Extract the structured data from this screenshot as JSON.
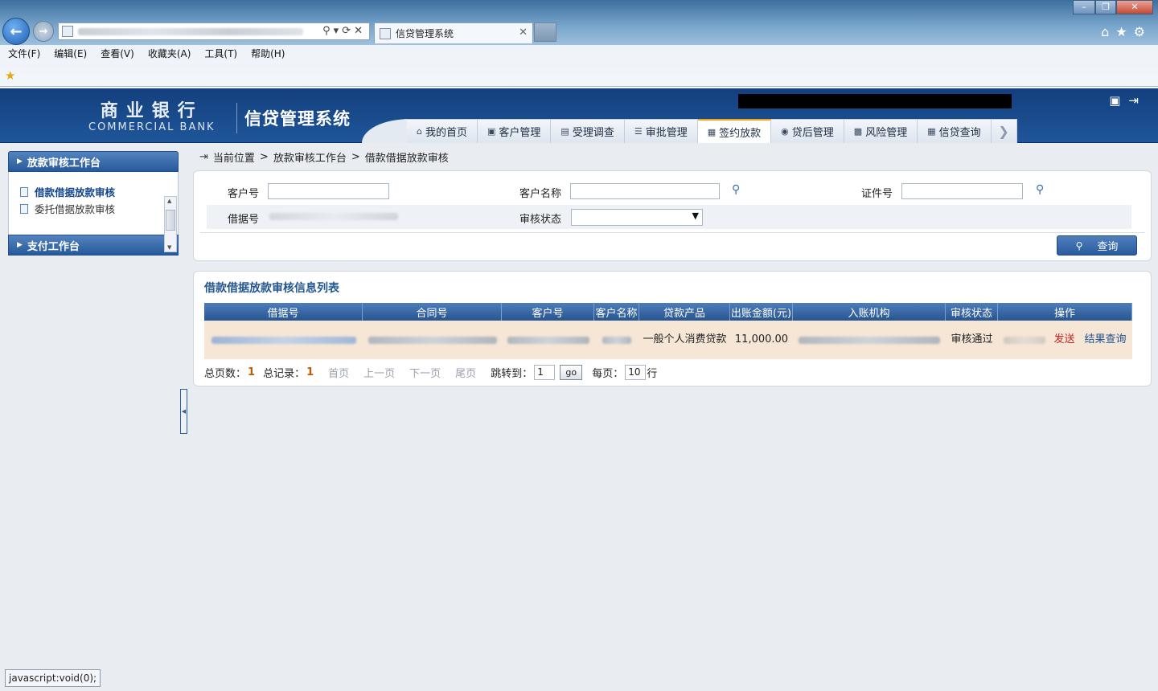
{
  "browser": {
    "tab_title": "信贷管理系统",
    "menu": [
      "文件(F)",
      "编辑(E)",
      "查看(V)",
      "收藏夹(A)",
      "工具(T)",
      "帮助(H)"
    ],
    "status_text": "javascript:void(0);"
  },
  "header": {
    "logo_cn": "商业银行",
    "logo_en": "COMMERCIAL BANK",
    "system_title": "信贷管理系统",
    "nav_tabs": [
      {
        "label": "我的首页",
        "icon": "home-icon"
      },
      {
        "label": "客户管理",
        "icon": "customer-icon"
      },
      {
        "label": "受理调查",
        "icon": "survey-icon"
      },
      {
        "label": "审批管理",
        "icon": "approval-icon"
      },
      {
        "label": "签约放款",
        "icon": "contract-icon",
        "active": true
      },
      {
        "label": "贷后管理",
        "icon": "postloan-icon"
      },
      {
        "label": "风险管理",
        "icon": "risk-icon"
      },
      {
        "label": "信贷查询",
        "icon": "query-icon"
      }
    ]
  },
  "sidebar": {
    "section1": "放款审核工作台",
    "items": [
      {
        "label": "借款借据放款审核",
        "active": true
      },
      {
        "label": "委托借据放款审核",
        "active": false
      }
    ],
    "section2": "支付工作台"
  },
  "breadcrumb": {
    "prefix": "当前位置",
    "items": [
      "放款审核工作台",
      "借款借据放款审核"
    ],
    "sep": ">"
  },
  "search": {
    "customer_no_label": "客户号",
    "customer_name_label": "客户名称",
    "id_no_label": "证件号",
    "loan_no_label": "借据号",
    "status_label": "审核状态",
    "query_button": "查询"
  },
  "list": {
    "title": "借款借据放款审核信息列表",
    "columns": [
      "借据号",
      "合同号",
      "客户号",
      "客户名称",
      "贷款产品",
      "出账金额(元)",
      "入账机构",
      "审核状态",
      "操作"
    ],
    "rows": [
      {
        "product": "一般个人消费贷款",
        "amount": "11,000.00",
        "status": "审核通过",
        "action_send": "发送",
        "action_result": "结果查询"
      }
    ]
  },
  "pager": {
    "total_pages_label": "总页数：",
    "total_pages": "1",
    "total_records_label": "总记录：",
    "total_records": "1",
    "first": "首页",
    "prev": "上一页",
    "next": "下一页",
    "last": "尾页",
    "jump_label": "跳转到：",
    "jump_value": "1",
    "go": "go",
    "per_page_label": "每页：",
    "per_page": "10",
    "rows_unit": "行"
  }
}
